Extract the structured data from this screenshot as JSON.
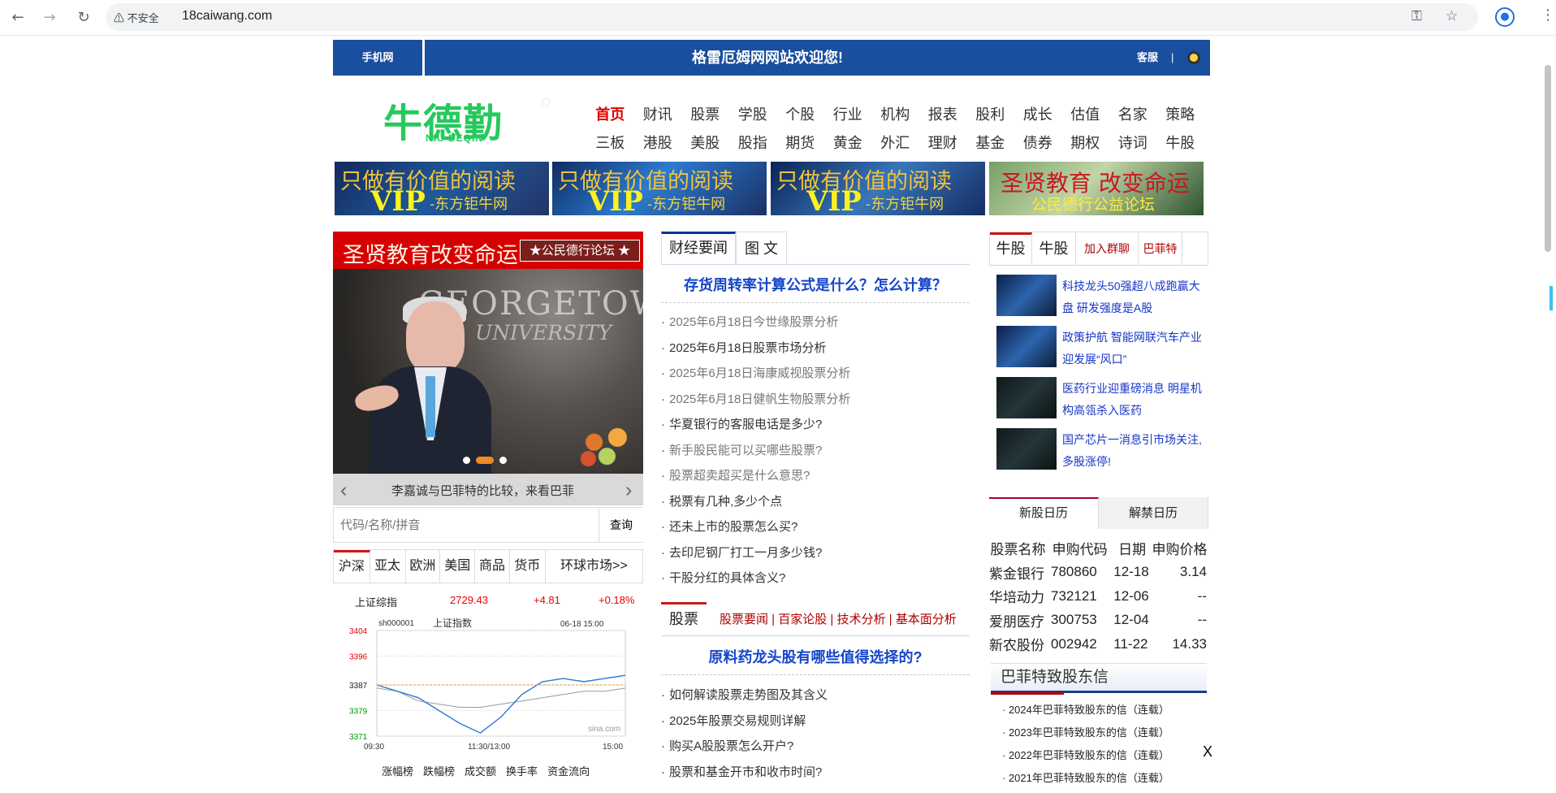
{
  "browser": {
    "security_label": "不安全",
    "url": "18caiwang.com"
  },
  "topbar": {
    "mobile": "手机网",
    "welcome": "格雷厄姆网网站欢迎您!",
    "service": "客服",
    "separator": "|"
  },
  "logo": {
    "name": "牛德勤",
    "subtitle": "NIU DEQIN"
  },
  "nav": [
    "首页",
    "财讯",
    "股票",
    "学股",
    "个股",
    "行业",
    "机构",
    "报表",
    "股利",
    "成长",
    "估值",
    "名家",
    "策略",
    "三板",
    "港股",
    "美股",
    "股指",
    "期货",
    "黄金",
    "外汇",
    "理财",
    "基金",
    "债券",
    "期权",
    "诗词",
    "牛股"
  ],
  "ads": [
    {
      "line1": "只做有价值的阅读",
      "line2": "VIP",
      "line3": "-东方钜牛网"
    },
    {
      "line1": "只做有价值的阅读",
      "line2": "VIP",
      "line3": "-东方钜牛网"
    },
    {
      "line1": "只做有价值的阅读",
      "line2": "VIP",
      "line3": "-东方钜牛网"
    },
    {
      "line1": "圣贤教育 改变命运",
      "line2": "公民德行公益论坛",
      "line3": ""
    }
  ],
  "left": {
    "banner_main": "圣贤教育改变命运",
    "banner_tag": "★公民德行论坛 ★",
    "photo_title": "GEORGETOWN",
    "photo_subtitle": "UNIVERSITY",
    "caption": "李嘉诚与巴菲特的比较，来看巴菲",
    "search_placeholder": "代码/名称/拼音",
    "search_button": "查询",
    "market_tabs": [
      "沪深",
      "亚太",
      "欧洲",
      "美国",
      "商品",
      "货币",
      "环球市场>>"
    ],
    "index": {
      "name": "上证综指",
      "value": "2729.43",
      "change": "+4.81",
      "percent": "+0.18%"
    },
    "chart_links": [
      "涨幅榜",
      "跌幅榜",
      "成交额",
      "换手率",
      "资金流向"
    ]
  },
  "chart_data": {
    "type": "line",
    "title": "上证指数",
    "code": "sh000001",
    "timestamp": "06-18 15:00",
    "x": [
      "09:30",
      "11:30/13:00",
      "15:00"
    ],
    "yticks": [
      3371,
      3379,
      3387,
      3396,
      3404
    ],
    "ylim": [
      3371,
      3404
    ],
    "series": [
      {
        "values": [
          3387,
          3385,
          3383,
          3379,
          3375,
          3372,
          3377,
          3384,
          3388,
          3389,
          3388,
          3389,
          3390
        ]
      },
      {
        "values": [
          3386,
          3385,
          3382,
          3381,
          3380,
          3380,
          3381,
          3382,
          3383,
          3384,
          3385,
          3385,
          3386
        ]
      }
    ],
    "watermark": "sina.com"
  },
  "middle": {
    "tabs": [
      "财经要闻",
      "图 文"
    ],
    "headline": "存货周转率计算公式是什么？怎么计算？",
    "news": [
      "2025年6月18日今世缘股票分析",
      "2025年6月18日股票市场分析",
      "2025年6月18日海康威视股票分析",
      "2025年6月18日健帆生物股票分析",
      "华夏银行的客服电话是多少?",
      "新手股民能可以买哪些股票?",
      "股票超卖超买是什么意思?",
      "税票有几种,多少个点",
      "还未上市的股票怎么买?",
      "去印尼钢厂打工一月多少钱?",
      "干股分红的具体含义?"
    ],
    "stock_tab": "股票",
    "stock_subnav": "股票要闻 | 百家论股 | 技术分析 | 基本面分析",
    "headline2": "原料药龙头股有哪些值得选择的?",
    "news2": [
      "如何解读股票走势图及其含义",
      "2025年股票交易规则详解",
      "购买A股股票怎么开户?",
      "股票和基金开市和收市时间?"
    ]
  },
  "right": {
    "tabs": [
      "牛股",
      "牛股",
      "加入群聊",
      "巴菲特"
    ],
    "items": [
      "科技龙头50强超八成跑赢大盘 研发强度是A股",
      "政策护航 智能网联汽车产业迎发展“风口”",
      "医药行业迎重磅消息 明星机构高瓴杀入医药",
      "国产芯片一消息引市场关注,多股涨停!"
    ],
    "ipo_tabs": [
      "新股日历",
      "解禁日历"
    ],
    "ipo_headers": [
      "股票名称",
      "申购代码",
      "日期",
      "申购价格"
    ],
    "ipo_rows": [
      [
        "紫金银行",
        "780860",
        "12-18",
        "3.14"
      ],
      [
        "华培动力",
        "732121",
        "12-06",
        "--"
      ],
      [
        "爱朋医疗",
        "300753",
        "12-04",
        "--"
      ],
      [
        "新农股份",
        "002942",
        "11-22",
        "14.33"
      ]
    ],
    "letters_title": "巴菲特致股东信",
    "letters": [
      "2024年巴菲特致股东的信（连载）",
      "2023年巴菲特致股东的信（连载）",
      "2022年巴菲特致股东的信（连载）",
      "2021年巴菲特致股东的信（连载）"
    ],
    "close": "X"
  }
}
